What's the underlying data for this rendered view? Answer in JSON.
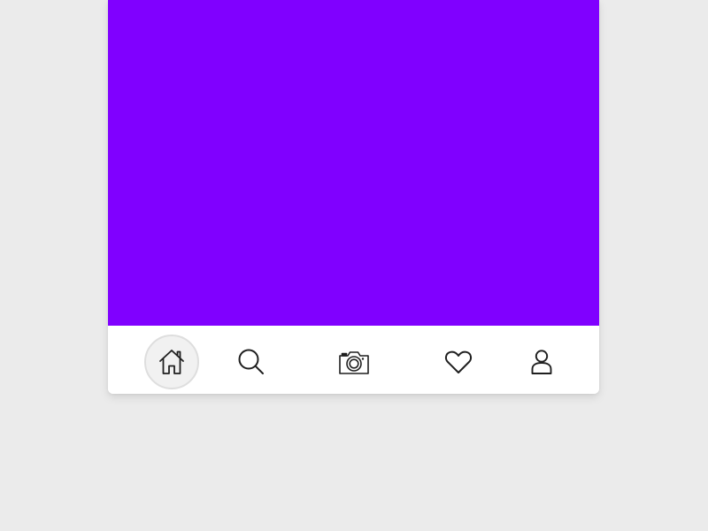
{
  "content": {
    "background_color": "#8000ff"
  },
  "bottom_nav": {
    "active_index": 0,
    "icon_color": "#1f1f1f",
    "items": [
      {
        "icon": "home-icon"
      },
      {
        "icon": "search-icon"
      },
      {
        "icon": "camera-icon"
      },
      {
        "icon": "heart-icon"
      },
      {
        "icon": "user-icon"
      }
    ]
  }
}
